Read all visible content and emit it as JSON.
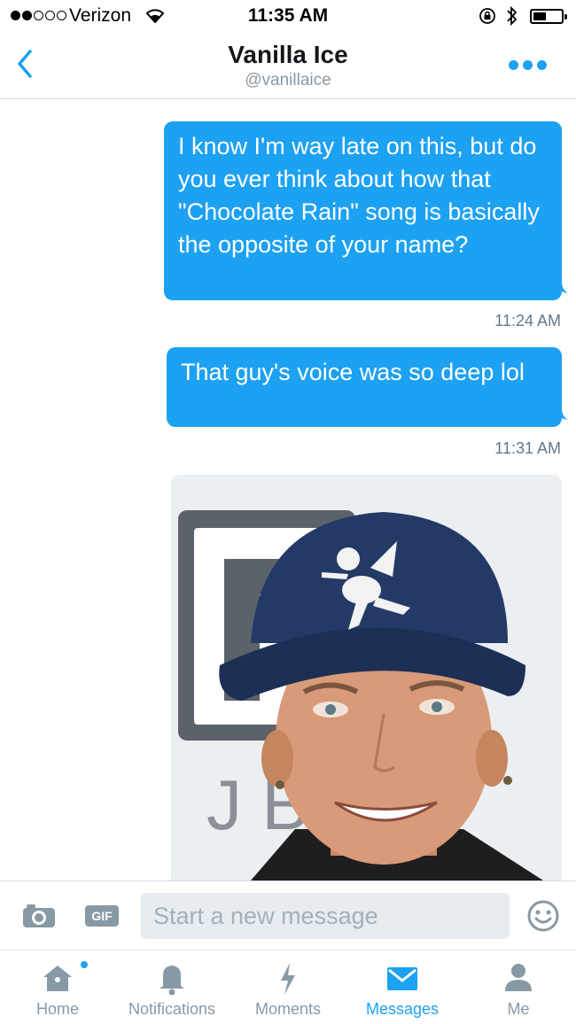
{
  "status_bar": {
    "carrier": "Verizon",
    "time": "11:35 AM"
  },
  "header": {
    "name": "Vanilla Ice",
    "handle": "@vanillaice"
  },
  "messages": [
    {
      "text": "I know I'm way late on this, but do you ever think about how that \"Chocolate Rain\" song is basically the opposite of your name?",
      "timestamp": "11:24 AM"
    },
    {
      "text": "That guy's voice was so deep lol",
      "timestamp": "11:31 AM"
    }
  ],
  "composer": {
    "gif_label": "GIF",
    "placeholder": "Start a new message"
  },
  "tabs": [
    {
      "label": "Home",
      "icon": "home-icon"
    },
    {
      "label": "Notifications",
      "icon": "bell-icon"
    },
    {
      "label": "Moments",
      "icon": "lightning-icon"
    },
    {
      "label": "Messages",
      "icon": "envelope-icon",
      "active": true
    },
    {
      "label": "Me",
      "icon": "person-icon"
    }
  ],
  "colors": {
    "accent": "#1da1f2",
    "muted": "#8899a6"
  }
}
